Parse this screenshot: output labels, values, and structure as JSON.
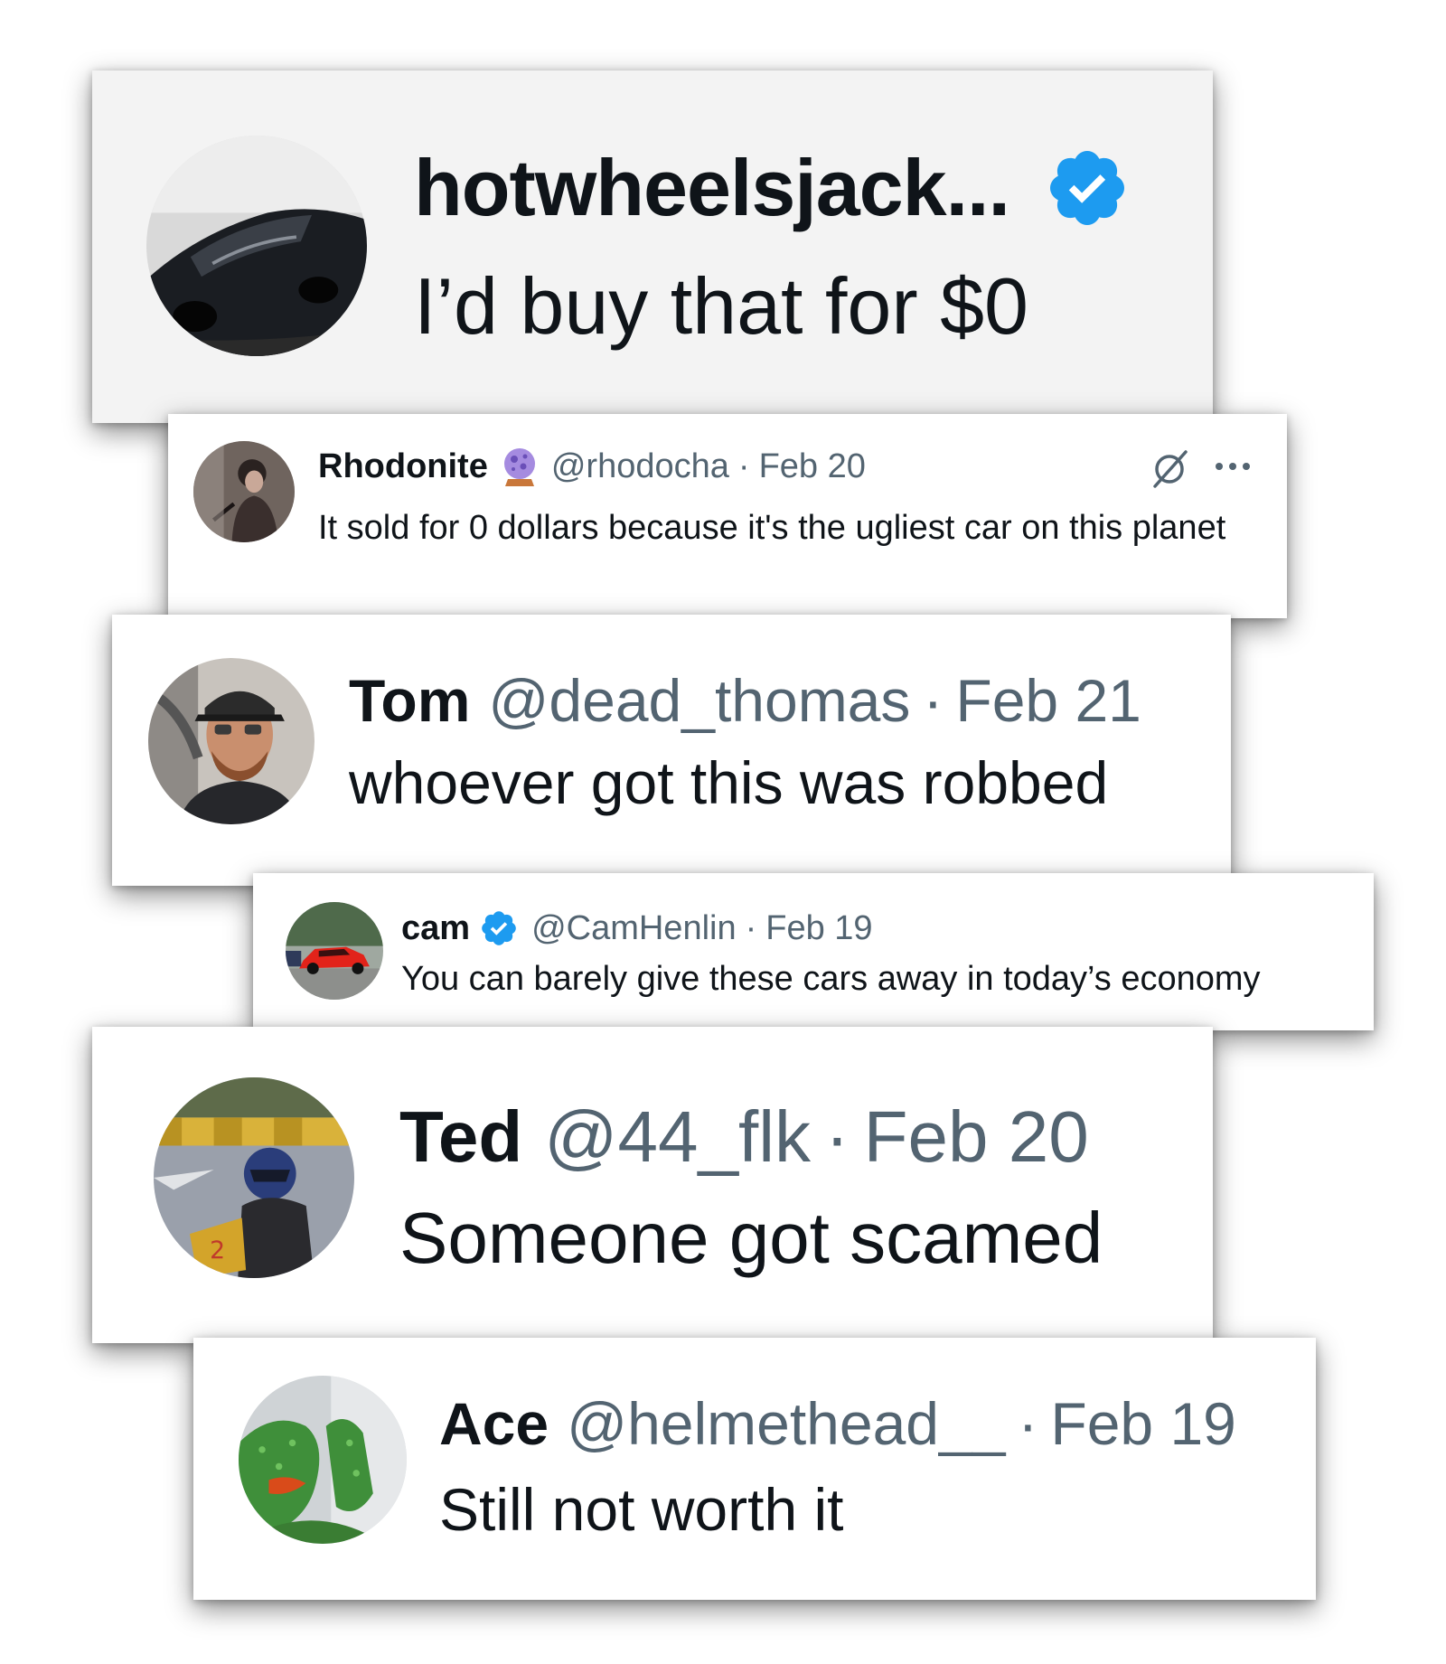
{
  "colors": {
    "verified_blue": "#1d9bf0",
    "text_primary": "#0f1419",
    "text_secondary": "#536471",
    "shadow": "#000000"
  },
  "tweets": [
    {
      "name": "hotwheelsjack...",
      "badge_icon": "verified-badge-icon",
      "text": "I’d buy that for $0",
      "avatar_icon": "avatar-black-car"
    },
    {
      "name": "Rhodonite",
      "badge_icon": "crystal-ball-emoji-icon",
      "handle": "@rhodocha",
      "separator": "·",
      "date": "Feb 20",
      "grok_icon": "grok-icon",
      "more_icon": "more-options-icon",
      "text": "It sold for 0 dollars because it's the ugliest car on this planet",
      "avatar_icon": "avatar-person-portrait"
    },
    {
      "name": "Tom",
      "handle": "@dead_thomas",
      "separator": "·",
      "date": "Feb 21",
      "text": "whoever got this was robbed",
      "avatar_icon": "avatar-man-in-car"
    },
    {
      "name": "cam",
      "badge_icon": "verified-badge-icon",
      "handle": "@CamHenlin",
      "separator": "·",
      "date": "Feb 19",
      "text": "You can barely give these cars away in today’s economy",
      "avatar_icon": "avatar-red-sports-car"
    },
    {
      "name": "Ted",
      "handle": "@44_flk",
      "separator": "·",
      "date": "Feb 20",
      "text": "Someone got scamed",
      "avatar_icon": "avatar-go-kart-racer"
    },
    {
      "name": "Ace",
      "handle": "@helmethead__",
      "separator": "·",
      "date": "Feb 19",
      "text": "Still not worth it",
      "avatar_icon": "avatar-green-frog-plush"
    }
  ]
}
